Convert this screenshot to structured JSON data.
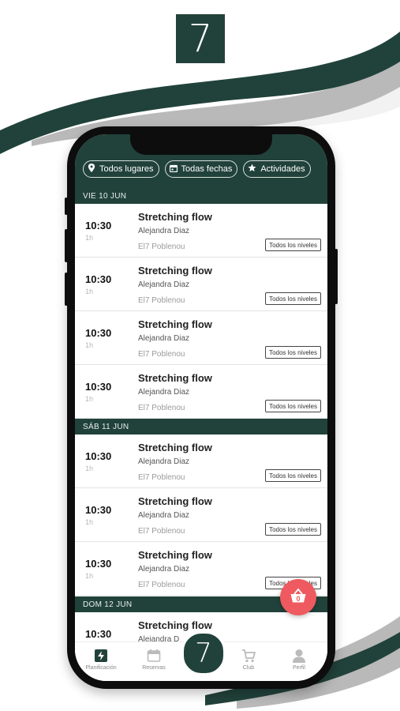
{
  "brand": {
    "logo_text": "7"
  },
  "filters": [
    {
      "icon": "location-pin-icon",
      "label": "Todos lugares"
    },
    {
      "icon": "calendar-icon",
      "label": "Todas fechas"
    },
    {
      "icon": "star-icon",
      "label": "Actividades"
    }
  ],
  "days": [
    {
      "label": "VIE 10 JUN"
    },
    {
      "label": "SÁB 11 JUN"
    },
    {
      "label": "DOM 12 JUN"
    }
  ],
  "classes": [
    {
      "time": "10:30",
      "duration": "1h",
      "title": "Stretching flow",
      "coach": "Alejandra Diaz",
      "place": "El7 Poblenou",
      "level": "Todos los niveles"
    },
    {
      "time": "10:30",
      "duration": "1h",
      "title": "Stretching flow",
      "coach": "Alejandra Diaz",
      "place": "El7 Poblenou",
      "level": "Todos los niveles"
    },
    {
      "time": "10:30",
      "duration": "1h",
      "title": "Stretching flow",
      "coach": "Alejandra Diaz",
      "place": "El7 Poblenou",
      "level": "Todos los niveles"
    },
    {
      "time": "10:30",
      "duration": "1h",
      "title": "Stretching flow",
      "coach": "Alejandra Diaz",
      "place": "El7 Poblenou",
      "level": "Todos los niveles"
    },
    {
      "time": "10:30",
      "duration": "1h",
      "title": "Stretching flow",
      "coach": "Alejandra Diaz",
      "place": "El7 Poblenou",
      "level": "Todos los niveles"
    },
    {
      "time": "10:30",
      "duration": "1h",
      "title": "Stretching flow",
      "coach": "Alejandra Diaz",
      "place": "El7 Poblenou",
      "level": "Todos los niveles"
    },
    {
      "time": "10:30",
      "duration": "1h",
      "title": "Stretching flow",
      "coach": "Alejandra Diaz",
      "place": "El7 Poblenou",
      "level": "Todos los niveles"
    },
    {
      "time": "10:30",
      "duration": "",
      "title": "Stretching flow",
      "coach": "Alejandra D",
      "place": "",
      "level": ""
    }
  ],
  "basket": {
    "count": "0"
  },
  "tabs": [
    {
      "label": "Planificación",
      "icon": "lightning-icon"
    },
    {
      "label": "Reservas",
      "icon": "calendar-icon"
    },
    {
      "label": "Club",
      "icon": "cart-icon"
    },
    {
      "label": "Perfil",
      "icon": "user-icon"
    }
  ],
  "colors": {
    "brand_green": "#21423a",
    "accent_red": "#ee5a5f",
    "swoosh_gray": "#b9b9b9"
  }
}
